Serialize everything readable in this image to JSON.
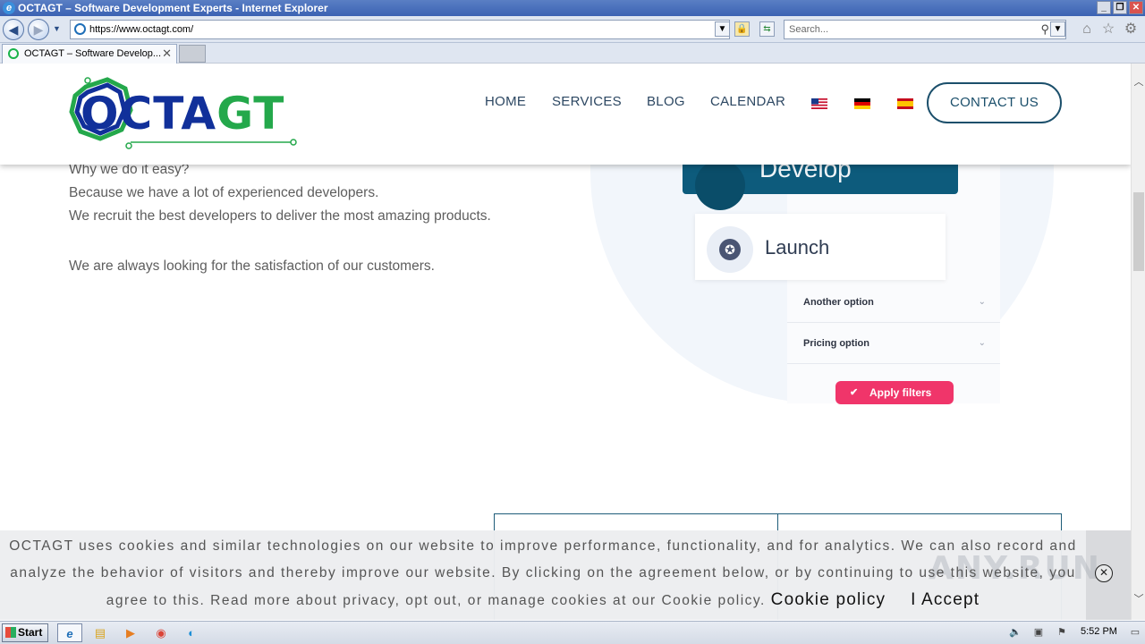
{
  "browser": {
    "window_title": "OCTAGT – Software Development Experts - Internet Explorer",
    "url": "https://www.octagt.com/",
    "search_placeholder": "Search...",
    "tab_title": "OCTAGT – Software Develop...",
    "window_controls": {
      "minimize": "_",
      "restore": "❐",
      "close": "✕"
    }
  },
  "site": {
    "logo": {
      "part1": "OCTA",
      "part2": "GT"
    },
    "nav": [
      {
        "label": "HOME"
      },
      {
        "label": "SERVICES"
      },
      {
        "label": "BLOG"
      },
      {
        "label": "CALENDAR"
      }
    ],
    "languages": [
      "us-flag",
      "de-flag",
      "es-flag"
    ],
    "contact_label": "CONTACT US"
  },
  "content": {
    "lines": [
      "Why we do it easy?",
      "Because we have a lot of experienced developers.",
      "We recruit the best developers to deliver the most amazing products.",
      "We are always looking for the satisfaction of our customers."
    ],
    "illustration": {
      "develop_label": "Develop",
      "launch_label": "Launch",
      "options": [
        "Another option",
        "Pricing option"
      ],
      "apply_label": "Apply filters"
    }
  },
  "cookie": {
    "line1": "OCTAGT uses cookies and similar technologies on our website to improve performance, functionality, and for analytics. We can also record and",
    "line2": "analyze the behavior of visitors and thereby improve our website. By clicking on the agreement below, or by continuing to use this website, you",
    "line3": "agree to this. Read more about privacy, opt out, or manage cookies at our Cookie policy.",
    "policy_link": "Cookie policy",
    "accept_label": "I Accept",
    "close_glyph": "✕",
    "watermark": "ANY.RUN"
  },
  "taskbar": {
    "start_label": "Start",
    "time": "5:52 PM"
  },
  "colors": {
    "brand_blue": "#11309a",
    "brand_green": "#24a84b",
    "nav_text": "#2c4762",
    "accent_dark": "#0d5b7c",
    "apply_pink": "#f0356a"
  }
}
